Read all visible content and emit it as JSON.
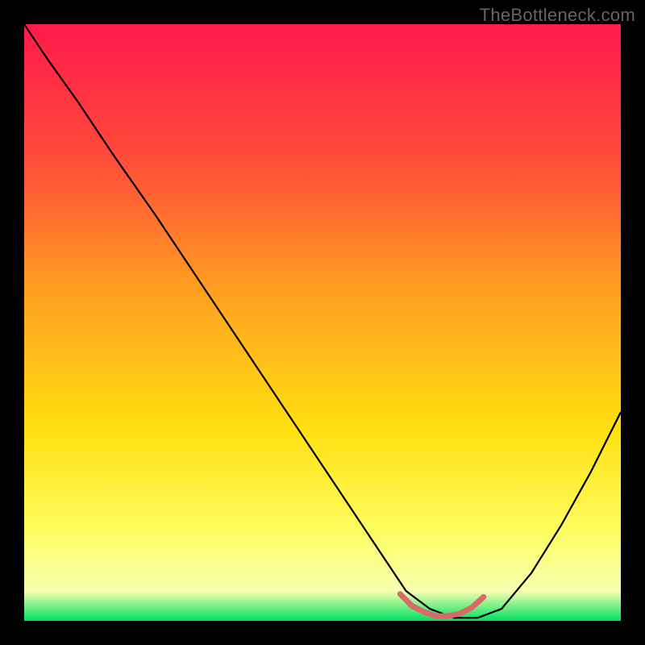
{
  "watermark": "TheBottleneck.com",
  "chart_data": {
    "type": "line",
    "title": "",
    "xlabel": "",
    "ylabel": "",
    "xlim": [
      0,
      100
    ],
    "ylim": [
      0,
      100
    ],
    "gradient_stops": [
      {
        "offset": 0,
        "color": "#ff1a4a"
      },
      {
        "offset": 22,
        "color": "#ff4a3a"
      },
      {
        "offset": 45,
        "color": "#ffa020"
      },
      {
        "offset": 68,
        "color": "#ffe010"
      },
      {
        "offset": 85,
        "color": "#fdfd60"
      },
      {
        "offset": 95,
        "color": "#f8ffb0"
      },
      {
        "offset": 100,
        "color": "#00e060"
      }
    ],
    "series": [
      {
        "name": "main-curve",
        "color": "#000000",
        "x": [
          0,
          4,
          9,
          15,
          22,
          30,
          38,
          46,
          54,
          60,
          64,
          68,
          72,
          76,
          80,
          85,
          90,
          95,
          100
        ],
        "y": [
          100,
          94,
          87,
          78,
          68,
          56,
          44,
          32,
          20,
          11,
          5,
          2,
          0.5,
          0.5,
          2,
          8,
          16,
          25,
          35
        ]
      },
      {
        "name": "valley-accent",
        "color": "#d86a6a",
        "x": [
          63,
          65,
          67,
          69,
          71,
          73,
          75,
          77
        ],
        "y": [
          4.5,
          2.5,
          1.5,
          0.8,
          0.8,
          1.2,
          2.2,
          4.0
        ]
      }
    ]
  }
}
